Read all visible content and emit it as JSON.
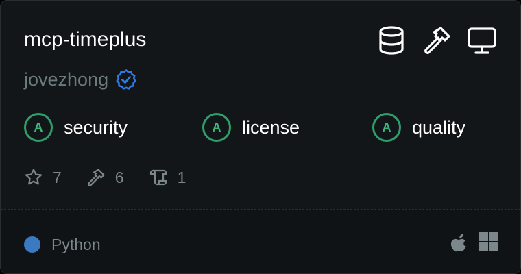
{
  "card": {
    "title": "mcp-timeplus",
    "author": "jovezhong",
    "top_icons": [
      "database-icon",
      "hammer-icon",
      "monitor-icon"
    ],
    "grades": [
      {
        "grade": "A",
        "label": "security"
      },
      {
        "grade": "A",
        "label": "license"
      },
      {
        "grade": "A",
        "label": "quality"
      }
    ],
    "stats": {
      "stars": "7",
      "tools": "6",
      "scroll": "1"
    },
    "footer": {
      "language": "Python",
      "language_color": "#3b79c0",
      "os_icons": [
        "apple-icon",
        "windows-icon"
      ]
    },
    "colors": {
      "grade_green": "#2e9e6a",
      "verified_blue": "#2f7be6"
    }
  }
}
